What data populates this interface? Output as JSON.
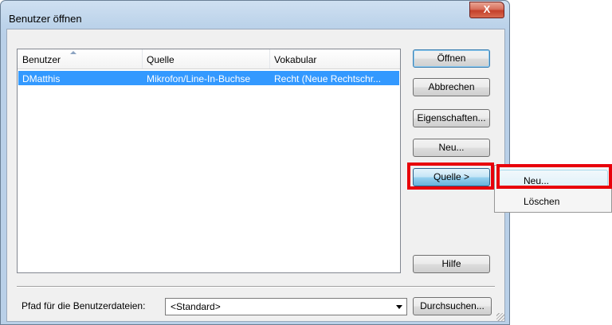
{
  "dialog": {
    "title": "Benutzer öffnen",
    "close_label": "X"
  },
  "list": {
    "columns": [
      "Benutzer",
      "Quelle",
      "Vokabular"
    ],
    "rows": [
      {
        "benutzer": "DMatthis",
        "quelle": "Mikrofon/Line-In-Buchse",
        "vokabular": "Recht (Neue Rechtschr..."
      }
    ],
    "sort_indicator": "ascending"
  },
  "buttons": {
    "open": "Öffnen",
    "cancel": "Abbrechen",
    "properties": "Eigenschaften...",
    "new": "Neu...",
    "source": "Quelle >",
    "help": "Hilfe",
    "browse": "Durchsuchen..."
  },
  "menu": {
    "items": [
      "Neu...",
      "Löschen"
    ]
  },
  "path": {
    "label": "Pfad für die Benutzerdateien:",
    "value": "<Standard>"
  },
  "colors": {
    "selection": "#3399ff",
    "highlight_box": "#e8000a",
    "title_gradient": "#bcd3ea"
  }
}
